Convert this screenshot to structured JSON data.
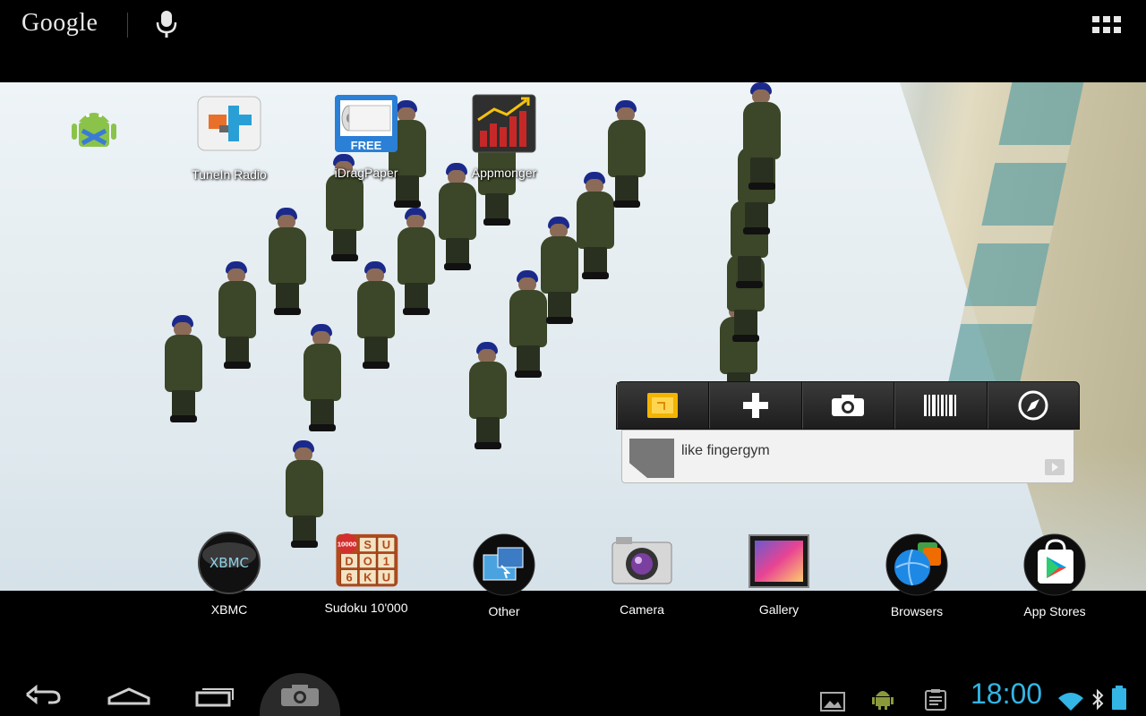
{
  "search_bar": {
    "logo_text": "Google",
    "mic_icon": "mic-icon",
    "apps_icon": "all-apps-grid-icon"
  },
  "desktop_top_apps": [
    {
      "label": "",
      "icon": "android-app-icon"
    },
    {
      "label": "TuneIn Radio",
      "icon": "tunein-radio-icon"
    },
    {
      "label": "iDragPaper",
      "icon": "toilet-paper-icon",
      "badge": "FREE"
    },
    {
      "label": "Appmonger",
      "icon": "bar-chart-icon"
    }
  ],
  "widget": {
    "toolbar": [
      {
        "name": "note-icon"
      },
      {
        "name": "plus-icon"
      },
      {
        "name": "camera-icon"
      },
      {
        "name": "barcode-icon"
      },
      {
        "name": "compass-icon"
      }
    ],
    "note_text": "like fingergym"
  },
  "dock": [
    {
      "label": "XBMC",
      "icon": "xbmc-icon",
      "text": "XBMC"
    },
    {
      "label": "Sudoku 10'000",
      "icon": "sudoku-icon",
      "tiles": [
        "S",
        "U",
        "D",
        "O",
        "1",
        "6",
        "K",
        "U"
      ],
      "badge": "10000"
    },
    {
      "label": "Other",
      "icon": "folder-other-icon"
    },
    {
      "label": "Camera",
      "icon": "camera-app-icon"
    },
    {
      "label": "Gallery",
      "icon": "gallery-icon"
    },
    {
      "label": "Browsers",
      "icon": "browsers-folder-icon"
    },
    {
      "label": "App Stores",
      "icon": "app-stores-folder-icon"
    }
  ],
  "navbar": {
    "back_icon": "back-icon",
    "home_icon": "home-icon",
    "recents_icon": "recent-apps-icon",
    "screenshot_icon": "screenshot-camera-icon",
    "notification_icons": [
      "picture-notification-icon",
      "android-notification-icon",
      "clipboard-notification-icon"
    ],
    "clock": "18:00",
    "status_icons": [
      "wifi-icon",
      "bluetooth-icon",
      "battery-icon"
    ]
  },
  "colors": {
    "accent": "#33b5e5",
    "background": "#000000"
  }
}
